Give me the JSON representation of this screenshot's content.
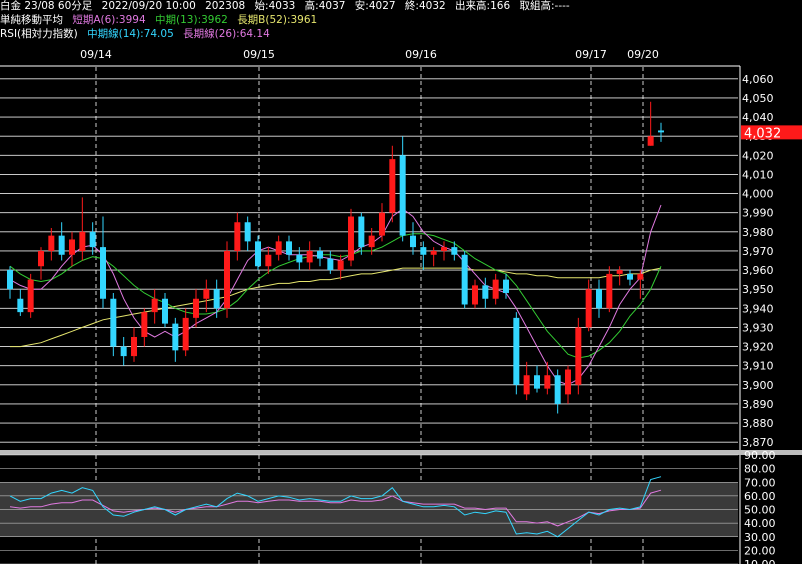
{
  "header": {
    "line1": {
      "instrument": "白金 23/08 60分足",
      "timestamp": "2022/09/20 10:00",
      "code": "202308",
      "open_label": "始:",
      "open": "4033",
      "high_label": "高:",
      "high": "4037",
      "low_label": "安:",
      "low": "4027",
      "close_label": "終:",
      "close": "4032",
      "volume_label": "出来高:",
      "volume": "166",
      "oi_label": "取組高:",
      "oi": "----"
    },
    "line2": {
      "title": "単純移動平均",
      "short": "短期A(6):3994",
      "mid": "中期(13):3962",
      "long": "長期B(52):3961"
    },
    "line3": {
      "title": "RSI(相対力指数)",
      "mid": "中期線(14):74.05",
      "long": "長期線(26):64.14"
    }
  },
  "colors": {
    "up": "#ff1a1a",
    "down": "#33d6ff",
    "ma_short": "#e079e0",
    "ma_mid": "#33cc33",
    "ma_long": "#e6e66e",
    "rsi_mid": "#33d6ff",
    "rsi_long": "#e079e0",
    "grid": "#ffffff",
    "last_price_bg": "#ff1a1a"
  },
  "chart_data": [
    {
      "type": "candlestick",
      "dates": [
        "09/14",
        "09/15",
        "09/16",
        "09/17",
        "09/20"
      ],
      "last_price": "4,032",
      "y_ticks": [
        "4,060",
        "4,050",
        "4,040",
        "4,030",
        "4,020",
        "4,010",
        "4,000",
        "3,990",
        "3,980",
        "3,970",
        "3,960",
        "3,950",
        "3,940",
        "3,930",
        "3,920",
        "3,910",
        "3,900",
        "3,890",
        "3,880",
        "3,870"
      ],
      "ylim": [
        3868,
        4062
      ],
      "candles": [
        {
          "o": 3960,
          "h": 3962,
          "l": 3945,
          "c": 3950
        },
        {
          "o": 3945,
          "h": 3950,
          "l": 3936,
          "c": 3938
        },
        {
          "o": 3938,
          "h": 3958,
          "l": 3935,
          "c": 3955
        },
        {
          "o": 3962,
          "h": 3972,
          "l": 3955,
          "c": 3970
        },
        {
          "o": 3970,
          "h": 3982,
          "l": 3965,
          "c": 3978
        },
        {
          "o": 3978,
          "h": 3985,
          "l": 3965,
          "c": 3968
        },
        {
          "o": 3968,
          "h": 3980,
          "l": 3962,
          "c": 3976
        },
        {
          "o": 3970,
          "h": 3998,
          "l": 3965,
          "c": 3980
        },
        {
          "o": 3980,
          "h": 3985,
          "l": 3968,
          "c": 3972
        },
        {
          "o": 3972,
          "h": 3988,
          "l": 3940,
          "c": 3945
        },
        {
          "o": 3945,
          "h": 3948,
          "l": 3915,
          "c": 3920
        },
        {
          "o": 3920,
          "h": 3925,
          "l": 3910,
          "c": 3915
        },
        {
          "o": 3915,
          "h": 3930,
          "l": 3912,
          "c": 3925
        },
        {
          "o": 3925,
          "h": 3940,
          "l": 3920,
          "c": 3938
        },
        {
          "o": 3938,
          "h": 3950,
          "l": 3932,
          "c": 3945
        },
        {
          "o": 3945,
          "h": 3948,
          "l": 3930,
          "c": 3932
        },
        {
          "o": 3932,
          "h": 3935,
          "l": 3912,
          "c": 3918
        },
        {
          "o": 3918,
          "h": 3940,
          "l": 3915,
          "c": 3935
        },
        {
          "o": 3935,
          "h": 3950,
          "l": 3930,
          "c": 3945
        },
        {
          "o": 3945,
          "h": 3955,
          "l": 3938,
          "c": 3950
        },
        {
          "o": 3950,
          "h": 3955,
          "l": 3935,
          "c": 3940
        },
        {
          "o": 3940,
          "h": 3975,
          "l": 3935,
          "c": 3970
        },
        {
          "o": 3970,
          "h": 3990,
          "l": 3965,
          "c": 3985
        },
        {
          "o": 3985,
          "h": 3988,
          "l": 3970,
          "c": 3975
        },
        {
          "o": 3975,
          "h": 3978,
          "l": 3960,
          "c": 3962
        },
        {
          "o": 3962,
          "h": 3972,
          "l": 3958,
          "c": 3968
        },
        {
          "o": 3968,
          "h": 3978,
          "l": 3965,
          "c": 3975
        },
        {
          "o": 3975,
          "h": 3978,
          "l": 3965,
          "c": 3968
        },
        {
          "o": 3968,
          "h": 3972,
          "l": 3960,
          "c": 3964
        },
        {
          "o": 3964,
          "h": 3975,
          "l": 3960,
          "c": 3970
        },
        {
          "o": 3970,
          "h": 3972,
          "l": 3962,
          "c": 3966
        },
        {
          "o": 3966,
          "h": 3970,
          "l": 3958,
          "c": 3960
        },
        {
          "o": 3960,
          "h": 3968,
          "l": 3955,
          "c": 3965
        },
        {
          "o": 3965,
          "h": 3992,
          "l": 3962,
          "c": 3988
        },
        {
          "o": 3988,
          "h": 3990,
          "l": 3968,
          "c": 3972
        },
        {
          "o": 3972,
          "h": 3982,
          "l": 3968,
          "c": 3978
        },
        {
          "o": 3978,
          "h": 3995,
          "l": 3975,
          "c": 3990
        },
        {
          "o": 3990,
          "h": 4025,
          "l": 3985,
          "c": 4018
        },
        {
          "o": 4020,
          "h": 4030,
          "l": 3975,
          "c": 3978
        },
        {
          "o": 3978,
          "h": 3985,
          "l": 3968,
          "c": 3972
        },
        {
          "o": 3972,
          "h": 3975,
          "l": 3960,
          "c": 3968
        },
        {
          "o": 3968,
          "h": 3972,
          "l": 3962,
          "c": 3970
        },
        {
          "o": 3970,
          "h": 3975,
          "l": 3965,
          "c": 3972
        },
        {
          "o": 3972,
          "h": 3975,
          "l": 3965,
          "c": 3968
        },
        {
          "o": 3968,
          "h": 3970,
          "l": 3940,
          "c": 3942
        },
        {
          "o": 3942,
          "h": 3955,
          "l": 3940,
          "c": 3952
        },
        {
          "o": 3952,
          "h": 3956,
          "l": 3940,
          "c": 3945
        },
        {
          "o": 3945,
          "h": 3958,
          "l": 3942,
          "c": 3955
        },
        {
          "o": 3955,
          "h": 3958,
          "l": 3945,
          "c": 3948
        },
        {
          "o": 3935,
          "h": 3938,
          "l": 3895,
          "c": 3900
        },
        {
          "o": 3895,
          "h": 3912,
          "l": 3892,
          "c": 3905
        },
        {
          "o": 3905,
          "h": 3910,
          "l": 3896,
          "c": 3898
        },
        {
          "o": 3898,
          "h": 3912,
          "l": 3895,
          "c": 3905
        },
        {
          "o": 3905,
          "h": 3908,
          "l": 3885,
          "c": 3890
        },
        {
          "o": 3895,
          "h": 3910,
          "l": 3890,
          "c": 3908
        },
        {
          "o": 3900,
          "h": 3935,
          "l": 3895,
          "c": 3930
        },
        {
          "o": 3930,
          "h": 3955,
          "l": 3928,
          "c": 3950
        },
        {
          "o": 3950,
          "h": 3955,
          "l": 3935,
          "c": 3940
        },
        {
          "o": 3940,
          "h": 3962,
          "l": 3938,
          "c": 3958
        },
        {
          "o": 3958,
          "h": 3962,
          "l": 3952,
          "c": 3960
        },
        {
          "o": 3958,
          "h": 3960,
          "l": 3952,
          "c": 3955
        },
        {
          "o": 3955,
          "h": 3960,
          "l": 3945,
          "c": 3958
        },
        {
          "o": 4025,
          "h": 4048,
          "l": 4025,
          "c": 4030
        },
        {
          "o": 4033,
          "h": 4037,
          "l": 4027,
          "c": 4032
        }
      ],
      "ma_short": [
        3955,
        3952,
        3950,
        3950,
        3955,
        3962,
        3968,
        3972,
        3973,
        3968,
        3958,
        3945,
        3935,
        3928,
        3925,
        3928,
        3925,
        3928,
        3932,
        3935,
        3938,
        3945,
        3955,
        3965,
        3970,
        3972,
        3970,
        3968,
        3968,
        3968,
        3967,
        3966,
        3965,
        3968,
        3972,
        3974,
        3978,
        3988,
        3992,
        3988,
        3980,
        3975,
        3972,
        3970,
        3964,
        3958,
        3952,
        3950,
        3948,
        3940,
        3930,
        3920,
        3910,
        3902,
        3900,
        3903,
        3910,
        3920,
        3930,
        3942,
        3950,
        3956,
        3980,
        3994
      ],
      "ma_mid": [
        3962,
        3958,
        3955,
        3954,
        3955,
        3958,
        3962,
        3965,
        3967,
        3966,
        3962,
        3957,
        3952,
        3948,
        3945,
        3943,
        3940,
        3938,
        3937,
        3937,
        3938,
        3940,
        3944,
        3950,
        3955,
        3959,
        3962,
        3964,
        3966,
        3967,
        3968,
        3968,
        3967,
        3968,
        3970,
        3970,
        3972,
        3975,
        3978,
        3979,
        3979,
        3978,
        3976,
        3974,
        3970,
        3966,
        3963,
        3960,
        3958,
        3952,
        3944,
        3936,
        3928,
        3922,
        3916,
        3914,
        3915,
        3918,
        3922,
        3928,
        3936,
        3942,
        3950,
        3962
      ],
      "ma_long": [
        3920,
        3920,
        3921,
        3922,
        3924,
        3926,
        3928,
        3930,
        3932,
        3934,
        3935,
        3936,
        3937,
        3938,
        3939,
        3940,
        3941,
        3942,
        3943,
        3944,
        3945,
        3946,
        3948,
        3950,
        3951,
        3952,
        3953,
        3953,
        3954,
        3954,
        3955,
        3955,
        3956,
        3957,
        3958,
        3958,
        3959,
        3960,
        3961,
        3961,
        3961,
        3961,
        3961,
        3961,
        3961,
        3960,
        3960,
        3960,
        3959,
        3958,
        3958,
        3957,
        3957,
        3956,
        3956,
        3956,
        3956,
        3956,
        3957,
        3957,
        3958,
        3958,
        3960,
        3961
      ]
    },
    {
      "type": "line",
      "title": "RSI(相対力指数)",
      "y_ticks": [
        "90.00",
        "80.00",
        "70.00",
        "60.00",
        "50.00",
        "40.00",
        "30.00",
        "20.00",
        "10.00"
      ],
      "ylim": [
        10,
        90
      ],
      "series": [
        {
          "name": "中期線(14)",
          "values": [
            60,
            56,
            58,
            58,
            62,
            64,
            62,
            66,
            64,
            52,
            46,
            45,
            48,
            50,
            52,
            50,
            46,
            50,
            52,
            54,
            52,
            58,
            62,
            60,
            56,
            58,
            60,
            59,
            57,
            58,
            57,
            56,
            56,
            60,
            58,
            58,
            60,
            66,
            56,
            54,
            52,
            52,
            53,
            52,
            46,
            48,
            47,
            49,
            48,
            32,
            33,
            32,
            34,
            30,
            36,
            42,
            48,
            46,
            50,
            51,
            50,
            52,
            72,
            74.05
          ]
        },
        {
          "name": "長期線(26)",
          "values": [
            52,
            51,
            52,
            52,
            54,
            55,
            55,
            57,
            57,
            53,
            49,
            48,
            49,
            50,
            51,
            50,
            48,
            50,
            51,
            52,
            52,
            54,
            56,
            56,
            55,
            56,
            57,
            57,
            56,
            56,
            56,
            55,
            55,
            57,
            56,
            56,
            57,
            60,
            56,
            55,
            54,
            54,
            54,
            54,
            51,
            51,
            50,
            51,
            51,
            41,
            41,
            40,
            41,
            38,
            41,
            44,
            48,
            47,
            49,
            50,
            50,
            51,
            62,
            64.14
          ]
        }
      ],
      "zones": [
        70,
        30
      ]
    }
  ]
}
